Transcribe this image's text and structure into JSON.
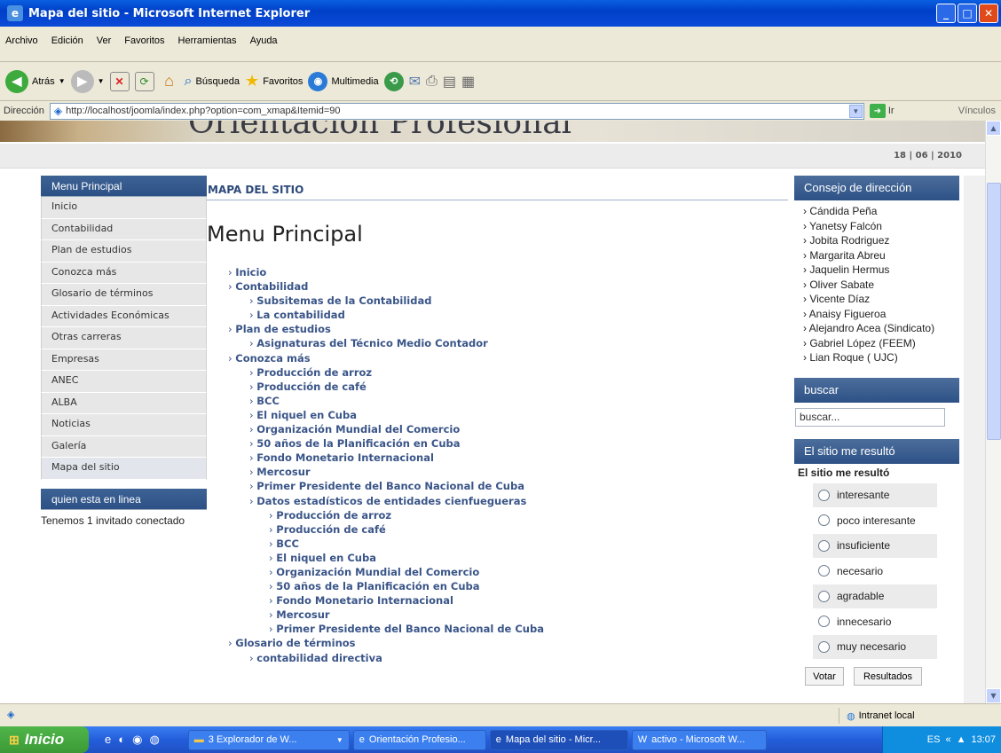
{
  "window": {
    "title": "Mapa del sitio - Microsoft Internet Explorer"
  },
  "menubar": [
    "Archivo",
    "Edición",
    "Ver",
    "Favoritos",
    "Herramientas",
    "Ayuda"
  ],
  "toolbar": {
    "back": "Atrás",
    "search": "Búsqueda",
    "favorites": "Favoritos",
    "multimedia": "Multimedia"
  },
  "address": {
    "label": "Dirección",
    "url": "http://localhost/joomla/index.php?option=com_xmap&Itemid=90",
    "go": "Ir",
    "links": "Vínculos"
  },
  "site": {
    "banner_title": "Orientación Profesional",
    "date": "18 | 06 | 2010"
  },
  "left_menu": {
    "title": "Menu Principal",
    "items": [
      "Inicio",
      "Contabilidad",
      "Plan de estudios",
      "Conozca más",
      "Glosario de términos",
      "Actividades Económicas",
      "Otras carreras",
      "Empresas",
      "ANEC",
      "ALBA",
      "Noticias",
      "Galería",
      "Mapa del sitio"
    ]
  },
  "online": {
    "title": "quien esta en linea",
    "text": "Tenemos 1 invitado conectado"
  },
  "main": {
    "section_title": "MAPA DEL SITIO",
    "heading": "Menu Principal",
    "tree": [
      {
        "level": 0,
        "text": "Inicio"
      },
      {
        "level": 0,
        "text": "Contabilidad"
      },
      {
        "level": 1,
        "text": "Subsitemas de la Contabilidad"
      },
      {
        "level": 1,
        "text": "La contabilidad"
      },
      {
        "level": 0,
        "text": "Plan de estudios"
      },
      {
        "level": 1,
        "text": "Asignaturas del Técnico Medio Contador"
      },
      {
        "level": 0,
        "text": "Conozca más"
      },
      {
        "level": 1,
        "text": "Producción de arroz"
      },
      {
        "level": 1,
        "text": "Producción de café"
      },
      {
        "level": 1,
        "text": "BCC"
      },
      {
        "level": 1,
        "text": "El niquel en Cuba"
      },
      {
        "level": 1,
        "text": "Organización Mundial del Comercio"
      },
      {
        "level": 1,
        "text": "50 años de la Planificación en Cuba"
      },
      {
        "level": 1,
        "text": "Fondo Monetario Internacional"
      },
      {
        "level": 1,
        "text": "Mercosur"
      },
      {
        "level": 1,
        "text": "Primer Presidente del Banco Nacional de Cuba"
      },
      {
        "level": 1,
        "text": "Datos estadísticos de entidades cienfuegueras"
      },
      {
        "level": 2,
        "text": "Producción de arroz"
      },
      {
        "level": 2,
        "text": "Producción de café"
      },
      {
        "level": 2,
        "text": "BCC"
      },
      {
        "level": 2,
        "text": "El niquel en Cuba"
      },
      {
        "level": 2,
        "text": "Organización Mundial del Comercio"
      },
      {
        "level": 2,
        "text": "50 años de la Planificación en Cuba"
      },
      {
        "level": 2,
        "text": "Fondo Monetario Internacional"
      },
      {
        "level": 2,
        "text": "Mercosur"
      },
      {
        "level": 2,
        "text": "Primer Presidente del Banco Nacional de Cuba"
      },
      {
        "level": 0,
        "text": "Glosario de términos"
      },
      {
        "level": 1,
        "text": "contabilidad directiva"
      }
    ]
  },
  "consejo": {
    "title": "Consejo de dirección",
    "people": [
      "Cándida Peña",
      "Yanetsy Falcón",
      "Jobita Rodriguez",
      "Margarita Abreu",
      "Jaquelin Hermus",
      "Oliver Sabate",
      "Vicente Díaz",
      "Anaisy Figueroa",
      "Alejandro Acea (Sindicato)",
      "Gabriel López (FEEM)",
      "Lian Roque ( UJC)"
    ]
  },
  "search": {
    "title": "buscar",
    "placeholder": "buscar..."
  },
  "poll": {
    "title": "El sitio me resultó",
    "question": "El sitio me resultó",
    "options": [
      "interesante",
      "poco interesante",
      "insuficiente",
      "necesario",
      "agradable",
      "innecesario",
      "muy necesario"
    ],
    "vote": "Votar",
    "results": "Resultados"
  },
  "status": {
    "zone": "Intranet local"
  },
  "taskbar": {
    "start": "Inicio",
    "tasks": [
      "3 Explorador de W...",
      "Orientación Profesio...",
      "Mapa del sitio - Micr...",
      "activo - Microsoft W..."
    ],
    "lang": "ES",
    "time": "13:07"
  }
}
